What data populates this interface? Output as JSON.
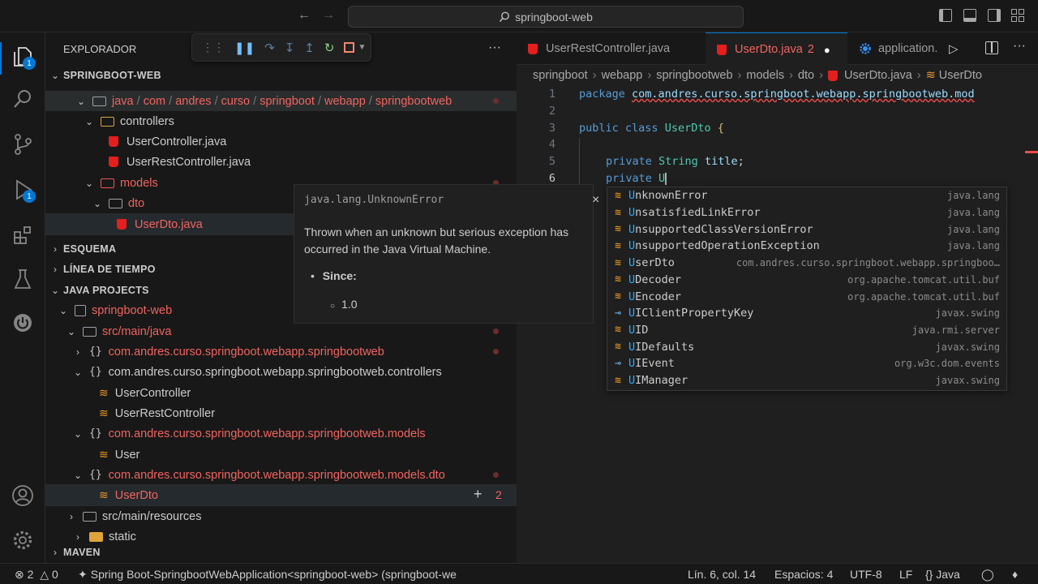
{
  "titlebar": {
    "search": "springboot-web",
    "back_icon": "arrow-left-icon",
    "forward_icon": "arrow-right-icon"
  },
  "activity": {
    "explorer_badge": "1",
    "run_badge": "1"
  },
  "sidebar": {
    "title": "EXPLORADOR",
    "more": "···",
    "root_folder": "SPRINGBOOT-WEB",
    "path_segments": [
      "java",
      "com",
      "andres",
      "curso",
      "springboot",
      "webapp",
      "springbootweb"
    ],
    "tree": {
      "controllers": "controllers",
      "user_controller": "UserController.java",
      "user_rest_controller": "UserRestController.java",
      "models": "models",
      "dto": "dto",
      "user_dto": "UserDto.java"
    },
    "sections": {
      "outline": "ESQUEMA",
      "timeline": "LÍNEA DE TIEMPO",
      "java_projects": "JAVA PROJECTS",
      "maven": "MAVEN"
    },
    "java_projects": {
      "project": "springboot-web",
      "src_main_java": "src/main/java",
      "pkg_root": "com.andres.curso.springboot.webapp.springbootweb",
      "pkg_controllers": "com.andres.curso.springboot.webapp.springbootweb.controllers",
      "cls_user_controller": "UserController",
      "cls_user_rest_controller": "UserRestController",
      "pkg_models": "com.andres.curso.springboot.webapp.springbootweb.models",
      "cls_user": "User",
      "pkg_dto": "com.andres.curso.springboot.webapp.springbootweb.models.dto",
      "cls_user_dto": "UserDto",
      "cls_user_dto_count": "2",
      "cls_user_dto_add": "+",
      "src_main_resources": "src/main/resources",
      "static": "static"
    }
  },
  "tabs": [
    {
      "label": "UserRestController.java",
      "active": false
    },
    {
      "label": "UserDto.java",
      "problems": "2",
      "modified_dot": "●",
      "active": true
    },
    {
      "label": "application.",
      "active": false
    }
  ],
  "breadcrumb": [
    "springboot",
    "webapp",
    "springbootweb",
    "models",
    "dto",
    "UserDto.java",
    "UserDto"
  ],
  "editor": {
    "line_numbers": [
      "1",
      "2",
      "3",
      "4",
      "5",
      "6"
    ],
    "line1_kw": "package",
    "line1_pkg": "com.andres.curso.springboot.webapp.springbootweb.mod",
    "line3_kw": "public class",
    "line3_name": "UserDto",
    "line3_brace": "{",
    "line5_kw": "private",
    "line5_type": "String",
    "line5_id": "title",
    "line5_semicolon": ";",
    "line6_kw": "private",
    "line6_typed": "U"
  },
  "hover_doc": {
    "signature": "java.lang.UnknownError",
    "description": "Thrown when an unknown but serious exception has occurred in the Java Virtual Machine.",
    "since_label": "Since:",
    "since_value": "1.0",
    "close": "×"
  },
  "suggestions": [
    {
      "match": "U",
      "rest": "nknownError",
      "detail": "java.lang",
      "kind": "class"
    },
    {
      "match": "U",
      "rest": "nsatisfiedLinkError",
      "detail": "java.lang",
      "kind": "class"
    },
    {
      "match": "U",
      "rest": "nsupportedClassVersionError",
      "detail": "java.lang",
      "kind": "class"
    },
    {
      "match": "U",
      "rest": "nsupportedOperationException",
      "detail": "java.lang",
      "kind": "class"
    },
    {
      "match": "U",
      "rest": "serDto",
      "detail": "com.andres.curso.springboot.webapp.springboo…",
      "kind": "class"
    },
    {
      "match": "U",
      "rest": "Decoder",
      "detail": "org.apache.tomcat.util.buf",
      "kind": "class"
    },
    {
      "match": "U",
      "rest": "Encoder",
      "detail": "org.apache.tomcat.util.buf",
      "kind": "class"
    },
    {
      "match": "U",
      "rest": "IClientPropertyKey",
      "detail": "javax.swing",
      "kind": "interface"
    },
    {
      "match": "U",
      "rest": "ID",
      "detail": "java.rmi.server",
      "kind": "class"
    },
    {
      "match": "U",
      "rest": "IDefaults",
      "detail": "javax.swing",
      "kind": "class"
    },
    {
      "match": "U",
      "rest": "IEvent",
      "detail": "org.w3c.dom.events",
      "kind": "interface"
    },
    {
      "match": "U",
      "rest": "IManager",
      "detail": "javax.swing",
      "kind": "class"
    }
  ],
  "statusbar": {
    "errors": "2",
    "warnings": "0",
    "run_config": "Spring Boot-SpringbootWebApplication<springboot-web> (springboot-we",
    "position": "Lín. 6, col. 14",
    "spaces": "Espacios: 4",
    "encoding": "UTF-8",
    "eol": "LF",
    "language": "Java"
  },
  "colors": {
    "accent": "#0078d4",
    "error_red": "#f1645f",
    "java_red": "#e51e1e",
    "class_orange": "#ee9d28"
  }
}
